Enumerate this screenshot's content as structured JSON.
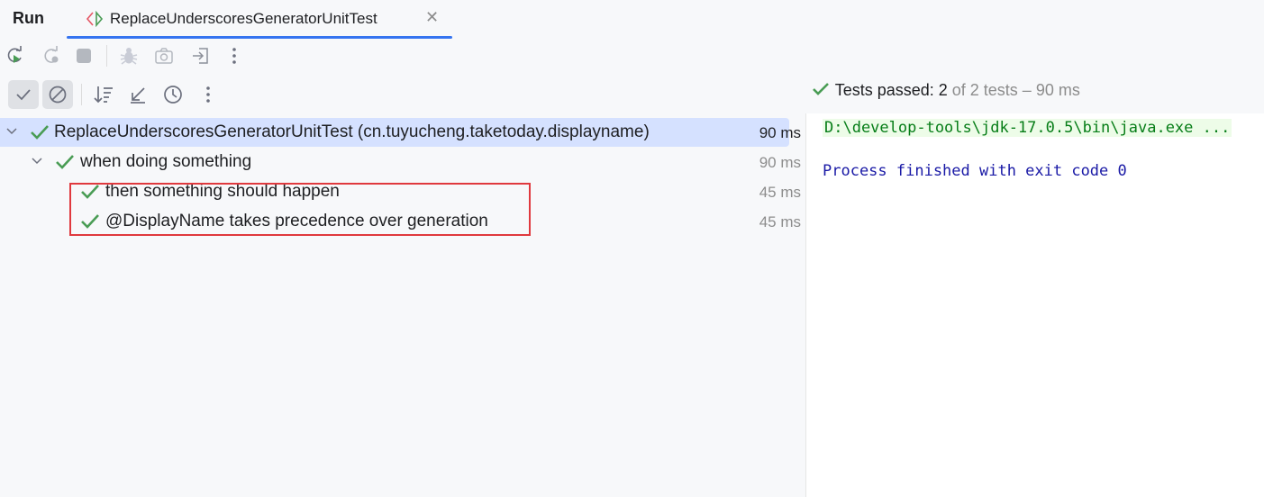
{
  "window": {
    "title": "Run",
    "tab_label": "ReplaceUnderscoresGeneratorUnitTest",
    "tab_close": "✕"
  },
  "toolbar": {
    "buttons": [
      "rerun-icon",
      "rerun-failed-icon",
      "stop-icon",
      "debug-icon",
      "screenshot-icon",
      "export-icon",
      "more-icon"
    ],
    "filter_buttons": [
      "show-passed-icon",
      "show-ignored-icon",
      "sort-icon",
      "collapse-icon",
      "history-icon",
      "more-icon"
    ]
  },
  "status": {
    "prefix": "Tests passed: ",
    "passed": "2",
    "rest": " of 2 tests – 90 ms"
  },
  "tree": [
    {
      "label": "ReplaceUnderscoresGeneratorUnitTest (cn.tuyucheng.taketoday.displayname)",
      "time": "90 ms",
      "level": 0,
      "expanded": true,
      "selected": true
    },
    {
      "label": "when doing something",
      "time": "90 ms",
      "level": 1,
      "expanded": true,
      "selected": false
    },
    {
      "label": "then something should happen",
      "time": "45 ms",
      "level": 2,
      "selected": false
    },
    {
      "label": "@DisplayName takes precedence over generation",
      "time": "45 ms",
      "level": 2,
      "selected": false
    }
  ],
  "console": {
    "line1": "D:\\develop-tools\\jdk-17.0.5\\bin\\java.exe ...",
    "line2": "Process finished with exit code 0"
  },
  "colors": {
    "accent": "#3574f0",
    "success": "#499c54",
    "selection": "#d5e1ff",
    "highlight_border": "#e0393e"
  }
}
